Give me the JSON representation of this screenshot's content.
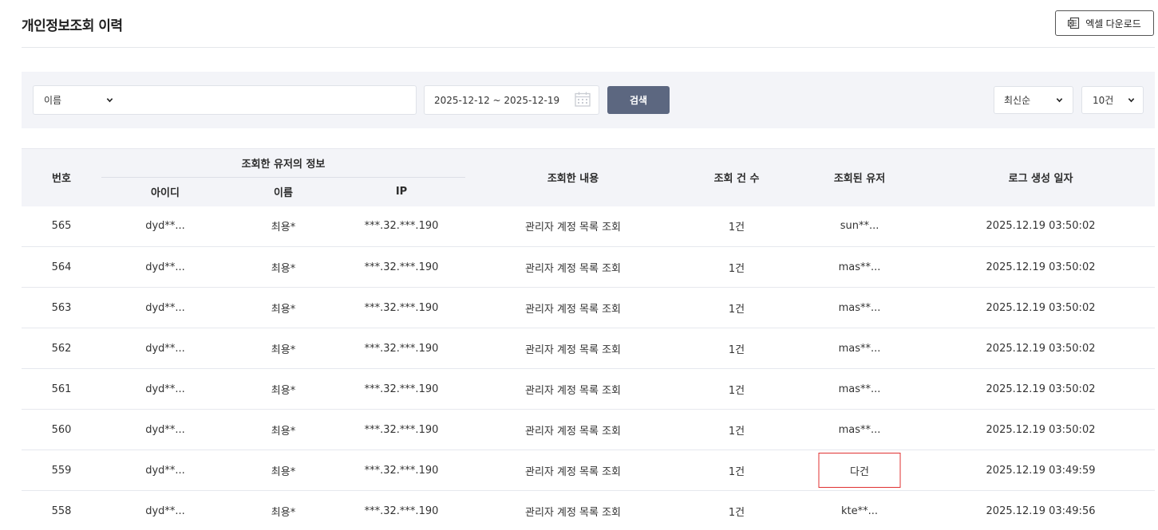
{
  "header": {
    "title": "개인정보조회 이력",
    "excel_button_label": "엑셀 다운로드"
  },
  "filters": {
    "search_field_selected": "이름",
    "search_input_value": "",
    "date_range": "2025-12-12 ~ 2025-12-19",
    "search_button_label": "검색",
    "sort_selected": "최신순",
    "page_size_selected": "10건"
  },
  "table": {
    "headers": {
      "number": "번호",
      "group_user_info": "조회한 유저의 정보",
      "id": "아이디",
      "name": "이름",
      "ip": "IP",
      "content": "조회한 내용",
      "count": "조회 건 수",
      "target_user": "조회된 유저",
      "created_at": "로그 생성 일자"
    },
    "rows": [
      {
        "no": "565",
        "id": "dyd**...",
        "name": "최용*",
        "ip": "***.32.***.190",
        "content": "관리자 계정 목록 조회",
        "count": "1건",
        "target": "sun**...",
        "date": "2025.12.19 03:50:02"
      },
      {
        "no": "564",
        "id": "dyd**...",
        "name": "최용*",
        "ip": "***.32.***.190",
        "content": "관리자 계정 목록 조회",
        "count": "1건",
        "target": "mas**...",
        "date": "2025.12.19 03:50:02"
      },
      {
        "no": "563",
        "id": "dyd**...",
        "name": "최용*",
        "ip": "***.32.***.190",
        "content": "관리자 계정 목록 조회",
        "count": "1건",
        "target": "mas**...",
        "date": "2025.12.19 03:50:02"
      },
      {
        "no": "562",
        "id": "dyd**...",
        "name": "최용*",
        "ip": "***.32.***.190",
        "content": "관리자 계정 목록 조회",
        "count": "1건",
        "target": "mas**...",
        "date": "2025.12.19 03:50:02"
      },
      {
        "no": "561",
        "id": "dyd**...",
        "name": "최용*",
        "ip": "***.32.***.190",
        "content": "관리자 계정 목록 조회",
        "count": "1건",
        "target": "mas**...",
        "date": "2025.12.19 03:50:02"
      },
      {
        "no": "560",
        "id": "dyd**...",
        "name": "최용*",
        "ip": "***.32.***.190",
        "content": "관리자 계정 목록 조회",
        "count": "1건",
        "target": "mas**...",
        "date": "2025.12.19 03:50:02"
      },
      {
        "no": "559",
        "id": "dyd**...",
        "name": "최용*",
        "ip": "***.32.***.190",
        "content": "관리자 계정 목록 조회",
        "count": "1건",
        "target": "다건",
        "date": "2025.12.19 03:49:59",
        "highlight": true
      },
      {
        "no": "558",
        "id": "dyd**...",
        "name": "최용*",
        "ip": "***.32.***.190",
        "content": "관리자 계정 목록 조회",
        "count": "1건",
        "target": "kte**...",
        "date": "2025.12.19 03:49:56"
      }
    ]
  },
  "colors": {
    "search_button_bg": "#5c6780",
    "filter_bar_bg": "#f3f4f8",
    "highlight_border": "#e03131"
  }
}
